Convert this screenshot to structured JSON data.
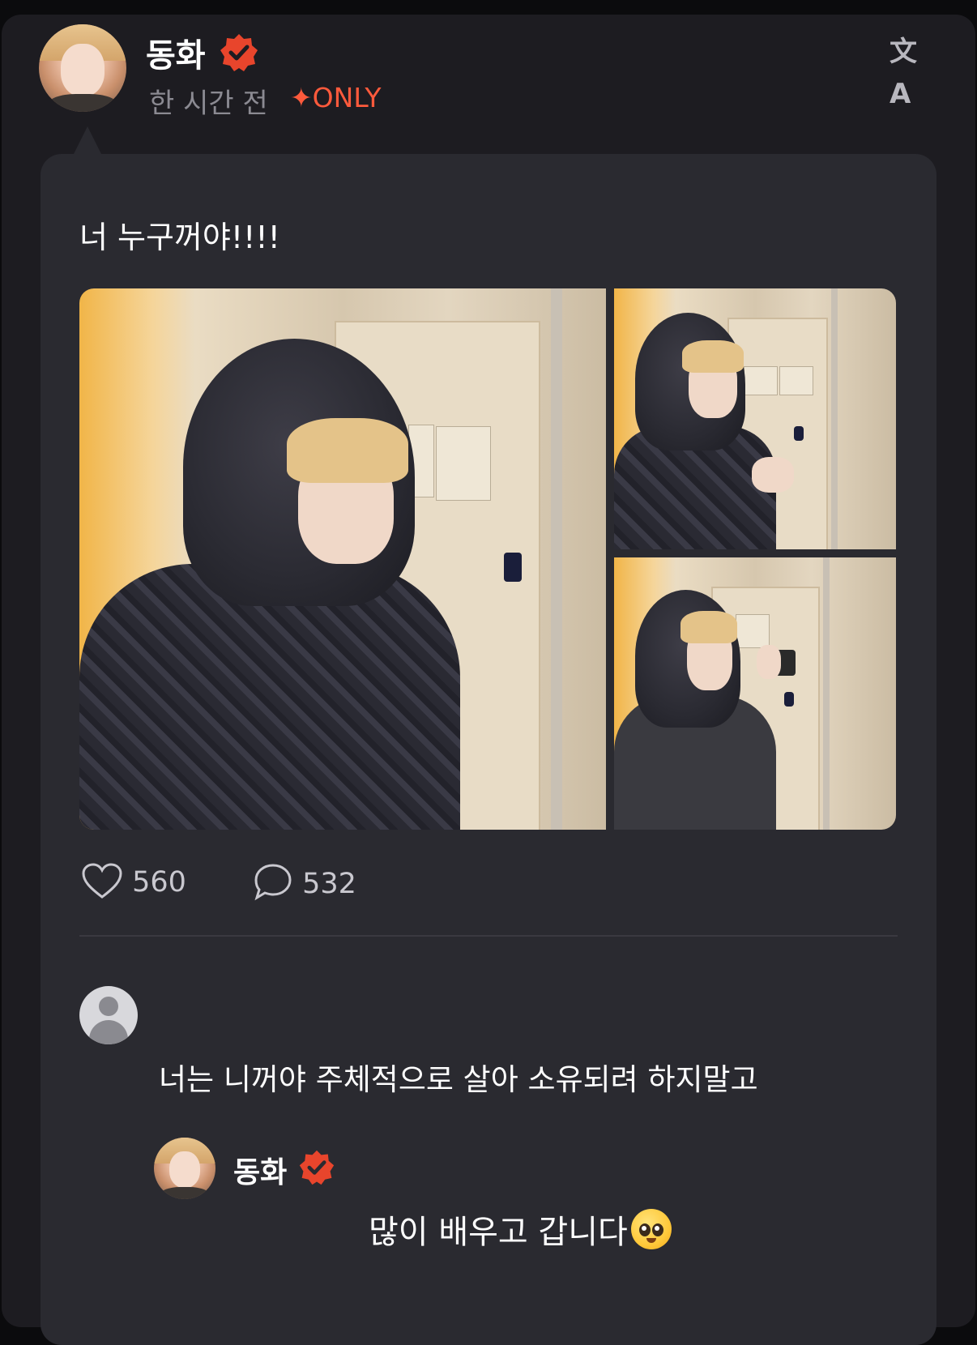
{
  "post": {
    "author": "동화",
    "time": "한 시간 전",
    "badge": "ONLY",
    "badge_icon": "sparkle-icon",
    "text": "너 누구꺼야!!!!",
    "likes": "560",
    "comments": "532",
    "translate_label": "文A"
  },
  "comments": [
    {
      "author": "",
      "text": "너는 니꺼야 주체적으로 살아 소유되려 하지말고",
      "reply": {
        "author": "동화",
        "text": "많이 배우고 갑니다"
      }
    }
  ],
  "colors": {
    "accent": "#ff5a3c",
    "background": "#1d1c21",
    "bubble": "#2a2a30",
    "verified": "#e8452c"
  }
}
